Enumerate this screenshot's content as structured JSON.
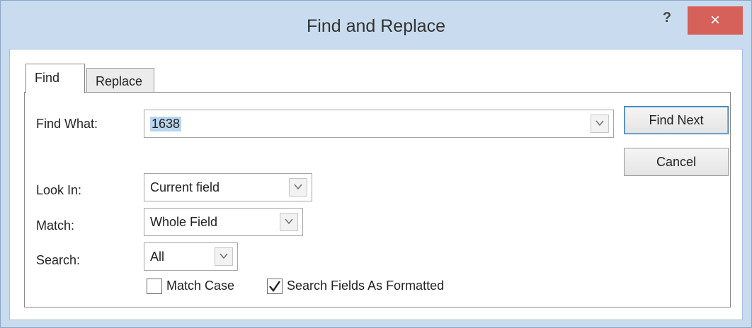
{
  "window": {
    "title": "Find and Replace",
    "help_label": "?",
    "close_label": "×"
  },
  "tabs": [
    {
      "label": "Find",
      "selected": true
    },
    {
      "label": "Replace",
      "selected": false
    }
  ],
  "find_what": {
    "label": "Find What:",
    "value": "1638"
  },
  "look_in": {
    "label": "Look In:",
    "value": "Current field"
  },
  "match": {
    "label": "Match:",
    "value": "Whole Field"
  },
  "search": {
    "label": "Search:",
    "value": "All"
  },
  "options": {
    "match_case": {
      "label": "Match Case",
      "checked": false
    },
    "search_formatted": {
      "label": "Search Fields As Formatted",
      "checked": true
    }
  },
  "buttons": {
    "find_next": "Find Next",
    "cancel": "Cancel"
  },
  "colors": {
    "close_button": "#d6605a",
    "window_frame": "#c9dcef",
    "selection": "#b9d5ef"
  }
}
